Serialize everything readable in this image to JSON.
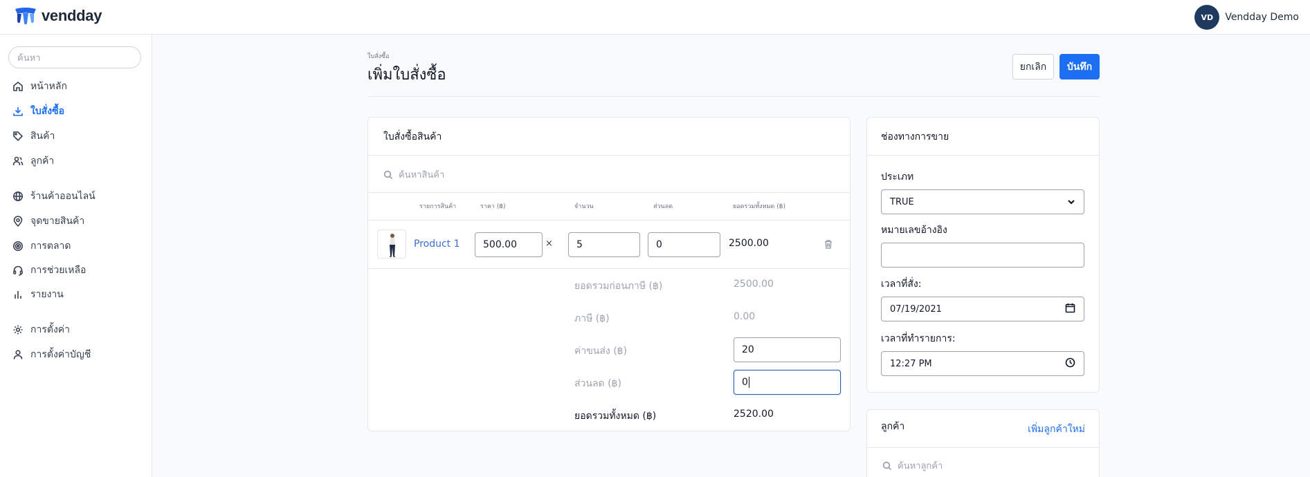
{
  "app": {
    "brand": "vendday"
  },
  "user": {
    "initials": "VD",
    "name": "Vendday Demo"
  },
  "sidebar": {
    "search_placeholder": "ค้นหา",
    "items": [
      {
        "label": "หน้าหลัก",
        "icon": "home-icon"
      },
      {
        "label": "ใบสั่งซื้อ",
        "icon": "download-icon",
        "active": true
      },
      {
        "label": "สินค้า",
        "icon": "tag-icon"
      },
      {
        "label": "ลูกค้า",
        "icon": "users-icon"
      },
      {
        "label": "ร้านค้าออนไลน์",
        "icon": "globe-icon"
      },
      {
        "label": "จุดขายสินค้า",
        "icon": "map-pin-icon"
      },
      {
        "label": "การตลาด",
        "icon": "target-icon"
      },
      {
        "label": "การช่วยเหลือ",
        "icon": "headset-icon"
      },
      {
        "label": "รายงาน",
        "icon": "bar-chart-icon"
      },
      {
        "label": "การตั้งค่า",
        "icon": "gear-icon"
      },
      {
        "label": "การตั้งค่าบัญชี",
        "icon": "user-icon"
      }
    ]
  },
  "header": {
    "breadcrumb": "ใบสั่งซื้อ",
    "title": "เพิ่มใบสั่งซื้อ",
    "cancel_label": "ยกเลิก",
    "save_label": "บันทึก"
  },
  "order": {
    "title": "ใบสั่งซื้อสินค้า",
    "search_placeholder": "ค้นหาสินค้า",
    "columns": [
      "รายการสินค้า",
      "ราคา (฿)",
      "จำนวน",
      "ส่วนลด",
      "ยอดรวมทั้งหมด (฿)"
    ],
    "rows": [
      {
        "name": "Product 1",
        "price": "500.00",
        "times": "×",
        "qty": "5",
        "discount": "0",
        "total": "2500.00"
      }
    ],
    "summary": {
      "subtotal_label": "ยอดรวมก่อนภาษี (฿)",
      "subtotal": "2500.00",
      "tax_label": "ภาษี (฿)",
      "tax": "0.00",
      "shipping_label": "ค่าขนส่ง (฿)",
      "shipping": "20",
      "discount_label": "ส่วนลด (฿)",
      "discount": "0",
      "grand_label": "ยอดรวมทั้งหมด (฿)",
      "grand": "2520.00"
    }
  },
  "channel": {
    "title": "ช่องทางการขาย",
    "type_label": "ประเภท",
    "type_value": "TRUE",
    "ref_label": "หมายเลขอ้างอิง",
    "ref_value": "",
    "order_time_label": "เวลาที่สั่ง:",
    "order_date": "07/19/2021",
    "trans_time_label": "เวลาที่ทำรายการ:",
    "trans_time": "12:27 PM"
  },
  "customer": {
    "title": "ลูกค้า",
    "add_label": "เพิ่มลูกค้าใหม่",
    "search_placeholder": "ค้นหาลูกค้า"
  },
  "colors": {
    "primary": "#1d6ff2",
    "link": "#3b6fd1",
    "avatar": "#1e3a5f"
  }
}
